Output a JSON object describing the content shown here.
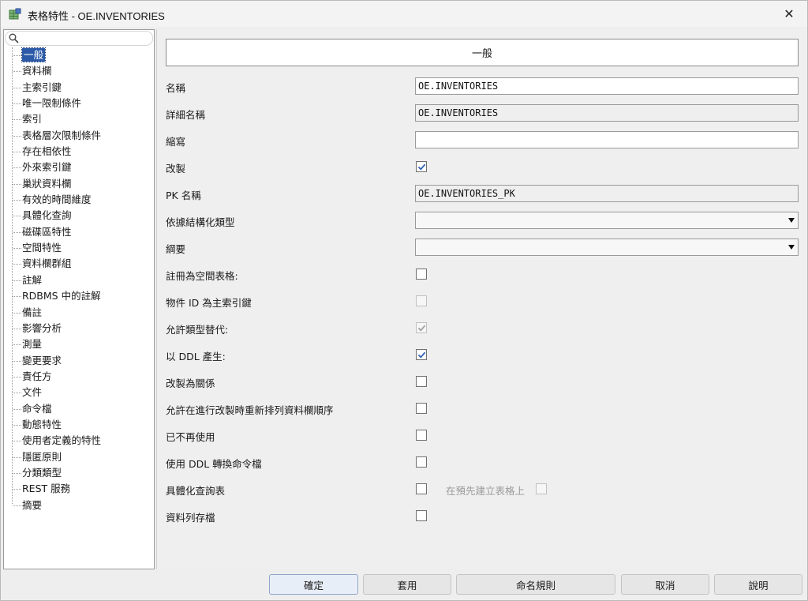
{
  "window": {
    "title": "表格特性 - OE.INVENTORIES"
  },
  "tree": {
    "items": [
      "一般",
      "資料欄",
      "主索引鍵",
      "唯一限制條件",
      "索引",
      "表格層次限制條件",
      "存在相依性",
      "外來索引鍵",
      "巢狀資料欄",
      "有效的時間維度",
      "具體化查詢",
      "磁碟區特性",
      "空間特性",
      "資料欄群組",
      "註解",
      "RDBMS 中的註解",
      "備註",
      "影響分析",
      "測量",
      "變更要求",
      "責任方",
      "文件",
      "命令檔",
      "動態特性",
      "使用者定義的特性",
      "隱匿原則",
      "分類類型",
      "REST 服務",
      "摘要"
    ],
    "selected_index": 0
  },
  "section": {
    "header": "一般"
  },
  "fields": {
    "name_label": "名稱",
    "name_value": "OE.INVENTORIES",
    "long_name_label": "詳細名稱",
    "long_name_value": "OE.INVENTORIES",
    "abbrev_label": "縮寫",
    "abbrev_value": "",
    "engineer_label": "改製",
    "engineer_checked": true,
    "pk_name_label": "PK 名稱",
    "pk_name_value": "OE.INVENTORIES_PK",
    "based_on_type_label": "依據結構化類型",
    "based_on_type_value": "",
    "schema_label": "綱要",
    "schema_value": "",
    "register_spatial_label": "註冊為空間表格:",
    "register_spatial_checked": false,
    "oid_pk_label": "物件 ID 為主索引鍵",
    "oid_pk_checked": false,
    "allow_subst_label": "允許類型替代:",
    "allow_subst_checked": true,
    "gen_ddl_label": "以 DDL 產生:",
    "gen_ddl_checked": true,
    "engineer_rel_label": "改製為關係",
    "engineer_rel_checked": false,
    "allow_reorder_label": "允許在進行改製時重新排列資料欄順序",
    "allow_reorder_checked": false,
    "deprecated_label": "已不再使用",
    "deprecated_checked": false,
    "ddl_transform_label": "使用 DDL 轉換命令檔",
    "ddl_transform_checked": false,
    "mv_label": "具體化查詢表",
    "mv_checked": false,
    "on_prebuilt_label": "在預先建立表格上",
    "on_prebuilt_checked": false,
    "row_archival_label": "資料列存檔",
    "row_archival_checked": false
  },
  "buttons": {
    "ok": "確定",
    "apply": "套用",
    "naming": "命名規則",
    "cancel": "取消",
    "help": "說明"
  },
  "colors": {
    "selection": "#2c5aa8",
    "check": "#2f5fb3",
    "disabled_check": "#a0a0a0"
  }
}
